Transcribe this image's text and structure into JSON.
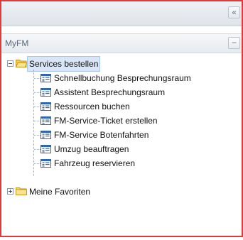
{
  "topbar": {
    "collapse_glyph": "«"
  },
  "panel": {
    "title": "MyFM",
    "minimize_glyph": "−"
  },
  "tree": {
    "services": {
      "label": "Services bestellen",
      "items": [
        "Schnellbuchung Besprechungsraum",
        "Assistent Besprechungsraum",
        "Ressourcen buchen",
        "FM-Service-Ticket erstellen",
        "FM-Service Botenfahrten",
        "Umzug beauftragen",
        "Fahrzeug reservieren"
      ]
    },
    "favorites": {
      "label": "Meine Favoriten"
    }
  },
  "colors": {
    "frame_border": "#e03a3a",
    "folder": "#f5cf5a",
    "doc_icon": "#2f66b3"
  },
  "icons": [
    "collapse-icon",
    "minimize-icon",
    "folder-open-icon",
    "folder-closed-icon",
    "form-icon"
  ]
}
